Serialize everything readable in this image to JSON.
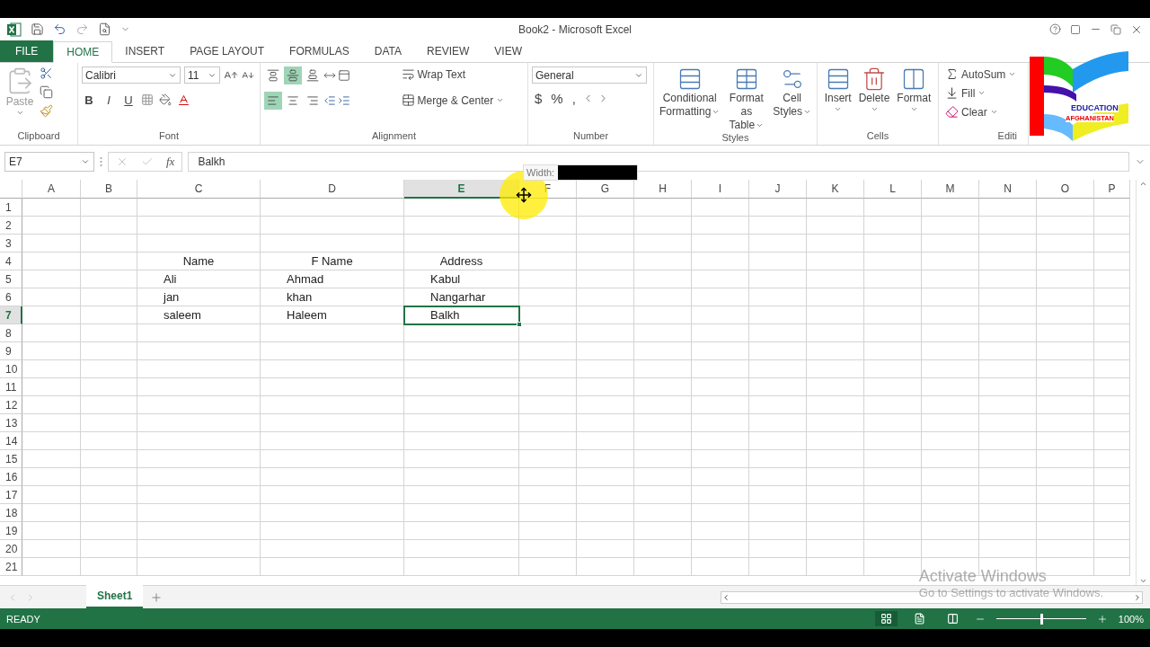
{
  "window": {
    "title": "Book2 - Microsoft Excel"
  },
  "tabs": [
    {
      "label": "FILE",
      "kind": "file",
      "selected": false
    },
    {
      "label": "HOME",
      "kind": "tab",
      "selected": true
    },
    {
      "label": "INSERT",
      "kind": "tab",
      "selected": false
    },
    {
      "label": "PAGE LAYOUT",
      "kind": "tab",
      "selected": false
    },
    {
      "label": "FORMULAS",
      "kind": "tab",
      "selected": false
    },
    {
      "label": "DATA",
      "kind": "tab",
      "selected": false
    },
    {
      "label": "REVIEW",
      "kind": "tab",
      "selected": false
    },
    {
      "label": "VIEW",
      "kind": "tab",
      "selected": false
    }
  ],
  "ribbon": {
    "groups": [
      {
        "kind": "clipboard",
        "label": "Clipboard",
        "paste": "Paste"
      },
      {
        "kind": "font",
        "label": "Font",
        "font_name": "Calibri",
        "font_size": "11",
        "bold": "B",
        "italic": "I",
        "underline": "U"
      },
      {
        "kind": "alignment",
        "label": "Alignment",
        "vertical": [
          {
            "selected": false
          },
          {
            "selected": true
          },
          {
            "selected": false
          }
        ],
        "horizontal": [
          {
            "selected": true
          },
          {
            "selected": false
          },
          {
            "selected": false
          }
        ],
        "wrap": "Wrap Text",
        "merge": "Merge & Center"
      },
      {
        "kind": "number",
        "label": "Number",
        "format": "General",
        "currency": "$",
        "percent": "%",
        "comma": ","
      },
      {
        "kind": "styles",
        "label": "Styles",
        "buttons": [
          [
            "Conditional",
            "Formatting"
          ],
          [
            "Format as",
            "Table"
          ],
          [
            "Cell",
            "Styles"
          ]
        ]
      },
      {
        "kind": "cells",
        "label": "Cells",
        "buttons": [
          "Insert",
          "Delete",
          "Format"
        ]
      },
      {
        "kind": "editing",
        "label": "Editi",
        "buttons": [
          "AutoSum",
          "Fill",
          "Clear"
        ]
      }
    ]
  },
  "logo": {
    "lines": [
      "EDUCATION",
      "AFGHANISTAN"
    ]
  },
  "formula_bar": {
    "name_box": "E7",
    "fx": "fx",
    "value": "Balkh"
  },
  "tooltip": {
    "label": "Width:"
  },
  "columns": [
    {
      "label": "A",
      "selected": false
    },
    {
      "label": "B",
      "selected": false
    },
    {
      "label": "C",
      "selected": false
    },
    {
      "label": "D",
      "selected": false
    },
    {
      "label": "E",
      "selected": true
    },
    {
      "label": "F",
      "selected": false
    },
    {
      "label": "G",
      "selected": false
    },
    {
      "label": "H",
      "selected": false
    },
    {
      "label": "I",
      "selected": false
    },
    {
      "label": "J",
      "selected": false
    },
    {
      "label": "K",
      "selected": false
    },
    {
      "label": "L",
      "selected": false
    },
    {
      "label": "M",
      "selected": false
    },
    {
      "label": "N",
      "selected": false
    },
    {
      "label": "O",
      "selected": false
    },
    {
      "label": "P",
      "selected": false
    }
  ],
  "rows": [
    {
      "label": "1",
      "selected": false,
      "kind": "blank"
    },
    {
      "label": "2",
      "selected": false,
      "kind": "blank"
    },
    {
      "label": "3",
      "selected": false,
      "kind": "blank"
    },
    {
      "label": "4",
      "selected": false,
      "kind": "header",
      "cells": {
        "C": "Name",
        "D": "F Name",
        "E": "Address"
      }
    },
    {
      "label": "5",
      "selected": false,
      "kind": "data",
      "cells": {
        "C": "Ali",
        "D": "Ahmad",
        "E": "Kabul"
      }
    },
    {
      "label": "6",
      "selected": false,
      "kind": "data",
      "cells": {
        "C": "jan",
        "D": "khan",
        "E": "Nangarhar"
      }
    },
    {
      "label": "7",
      "selected": true,
      "kind": "data",
      "cells": {
        "C": "saleem",
        "D": "Haleem",
        "E": "Balkh"
      }
    },
    {
      "label": "8",
      "selected": false,
      "kind": "blank"
    },
    {
      "label": "9",
      "selected": false,
      "kind": "blank"
    },
    {
      "label": "10",
      "selected": false,
      "kind": "blank"
    },
    {
      "label": "11",
      "selected": false,
      "kind": "blank"
    },
    {
      "label": "12",
      "selected": false,
      "kind": "blank"
    },
    {
      "label": "13",
      "selected": false,
      "kind": "blank"
    },
    {
      "label": "14",
      "selected": false,
      "kind": "blank"
    },
    {
      "label": "15",
      "selected": false,
      "kind": "blank"
    },
    {
      "label": "16",
      "selected": false,
      "kind": "blank"
    },
    {
      "label": "17",
      "selected": false,
      "kind": "blank"
    },
    {
      "label": "18",
      "selected": false,
      "kind": "blank"
    },
    {
      "label": "19",
      "selected": false,
      "kind": "blank"
    },
    {
      "label": "20",
      "selected": false,
      "kind": "blank"
    },
    {
      "label": "21",
      "selected": false,
      "kind": "blank"
    }
  ],
  "sheet_tabs": [
    {
      "label": "Sheet1",
      "selected": true
    }
  ],
  "activation_notice": {
    "title": "Activate Windows",
    "text": "Go to Settings to activate Windows."
  },
  "status_bar": {
    "status": "READY",
    "views": [
      {
        "selected": true
      },
      {
        "selected": false
      },
      {
        "selected": false
      }
    ],
    "zoom_slider": {
      "level": 0.5
    },
    "zoom": "100%"
  }
}
